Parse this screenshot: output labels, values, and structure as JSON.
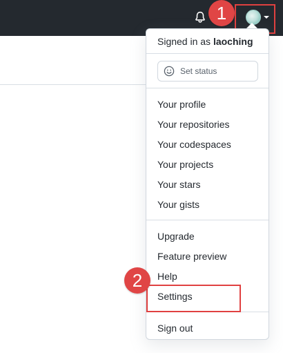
{
  "header": {
    "bell_icon": "bell-icon",
    "avatar_icon": "avatar-icon",
    "caret_icon": "caret-down-icon"
  },
  "annotations": {
    "badge_1": "1",
    "badge_2": "2",
    "highlight_color": "#e04040"
  },
  "dropdown": {
    "signed_in_prefix": "Signed in as",
    "username": "laoching",
    "set_status_label": "Set status",
    "set_status_icon": "smiley-icon",
    "group1": [
      "Your profile",
      "Your repositories",
      "Your codespaces",
      "Your projects",
      "Your stars",
      "Your gists"
    ],
    "group2": [
      "Upgrade",
      "Feature preview",
      "Help",
      "Settings"
    ],
    "sign_out": "Sign out"
  },
  "colors": {
    "header_bg": "#24292f",
    "text": "#24292f",
    "badge_bg": "#e04545"
  }
}
